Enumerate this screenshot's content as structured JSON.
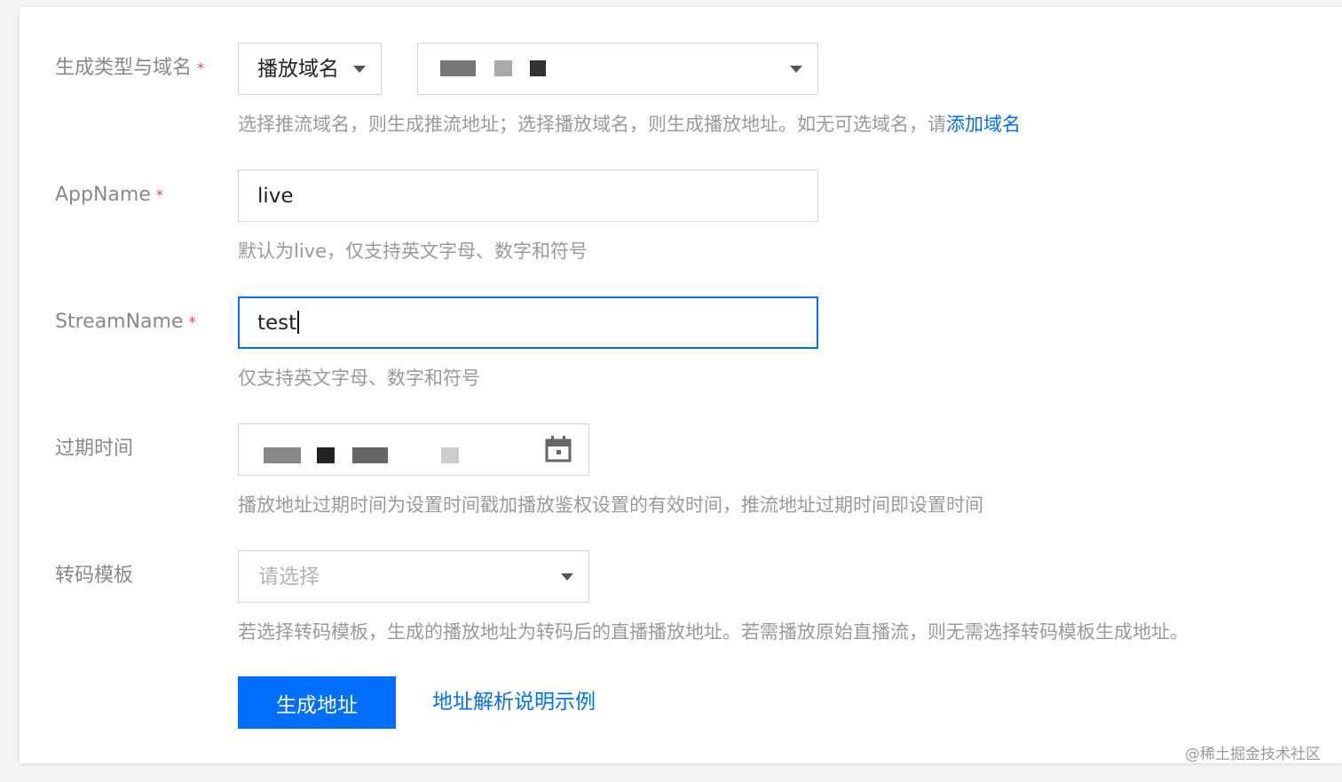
{
  "form": {
    "domain": {
      "label": "生成类型与域名",
      "required_mark": "*",
      "type_value": "播放域名",
      "help_text": "选择推流域名，则生成推流地址；选择播放域名，则生成播放地址。如无可选域名，请",
      "help_link": "添加域名"
    },
    "app_name": {
      "label": "AppName",
      "required_mark": "*",
      "value": "live",
      "help_text": "默认为live，仅支持英文字母、数字和符号"
    },
    "stream_name": {
      "label": "StreamName",
      "required_mark": "*",
      "value": "test",
      "help_text": "仅支持英文字母、数字和符号"
    },
    "expire_time": {
      "label": "过期时间",
      "help_text": "播放地址过期时间为设置时间戳加播放鉴权设置的有效时间，推流地址过期时间即设置时间"
    },
    "transcode": {
      "label": "转码模板",
      "placeholder": "请选择",
      "help_text": "若选择转码模板，生成的播放地址为转码后的直播播放地址。若需播放原始直播流，则无需选择转码模板生成地址。"
    }
  },
  "actions": {
    "generate_label": "生成地址",
    "example_link": "地址解析说明示例"
  },
  "watermark": "@稀土掘金技术社区",
  "icons": {
    "dropdown": "chevron-down-icon",
    "calendar": "calendar-icon"
  },
  "colors": {
    "accent": "#006eff",
    "required": "#e54545",
    "label": "#888888",
    "help": "#999999"
  }
}
